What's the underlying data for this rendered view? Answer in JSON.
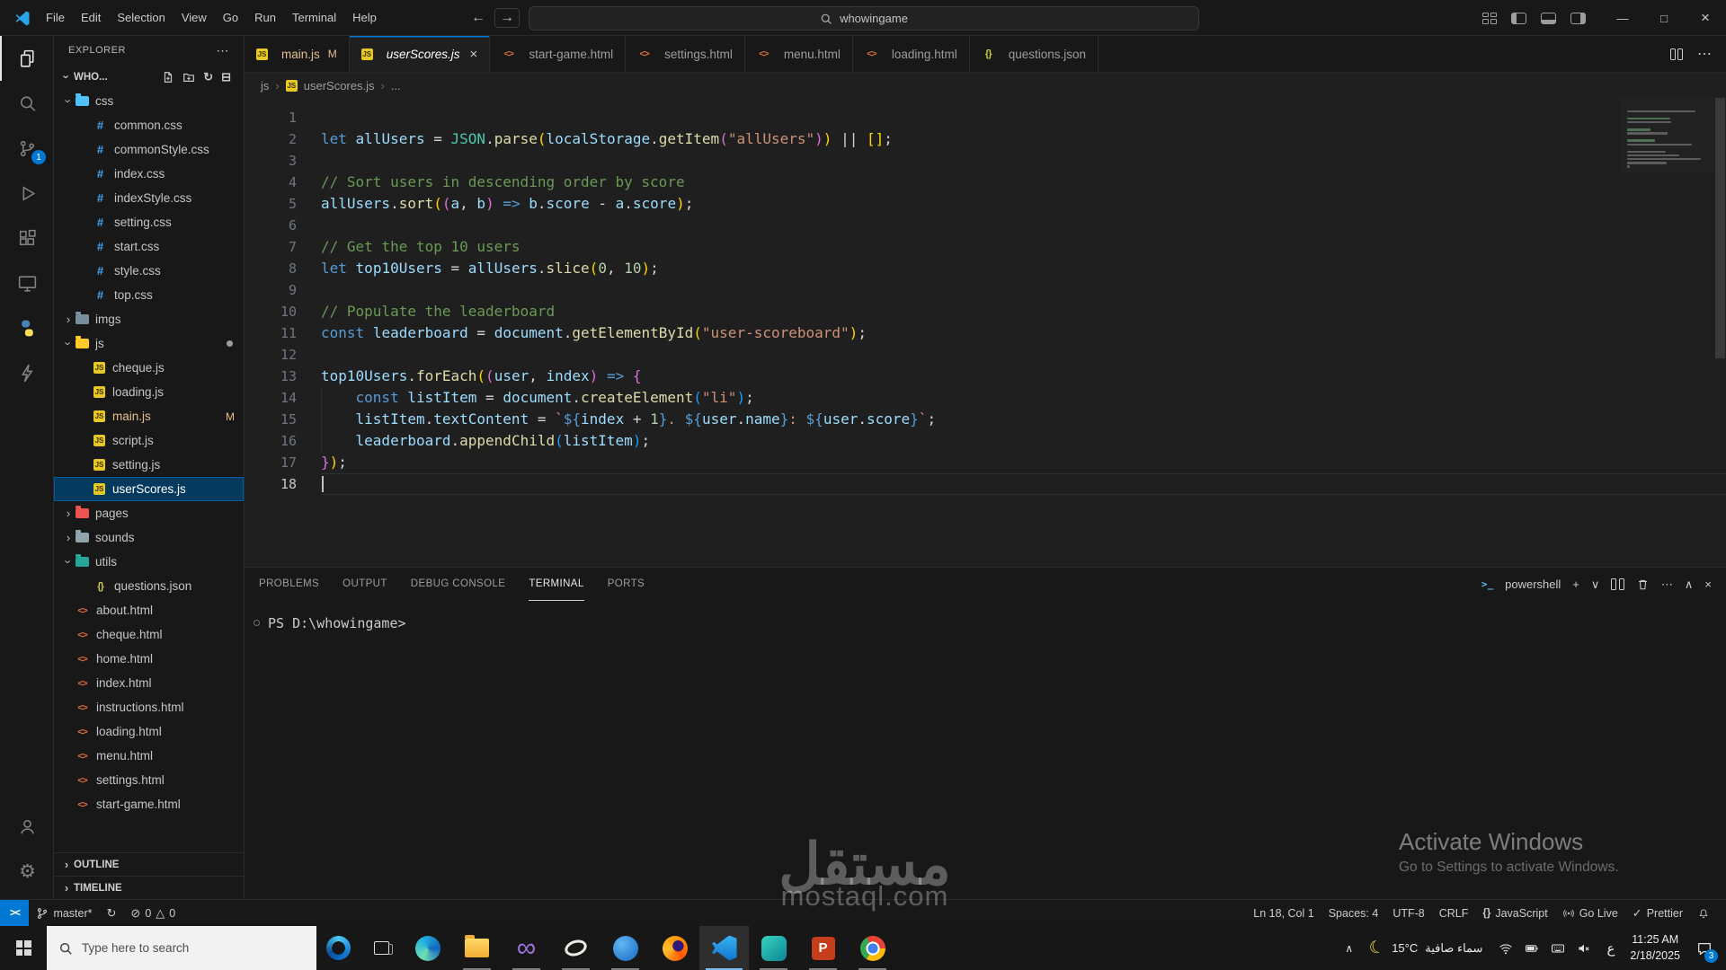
{
  "colors": {
    "accent": "#0078d4",
    "editor_bg": "#1f1f1f",
    "shell_bg": "#181818",
    "border": "#2b2b2b",
    "text": "#cccccc",
    "selection": "#04395e",
    "git_modified": "#e2c08d",
    "tok_kw": "#569cd6",
    "tok_var": "#9cdcfe",
    "tok_fn": "#dcdcaa",
    "tok_cls": "#4ec9b0",
    "tok_str": "#ce9178",
    "tok_num": "#b5cea8",
    "tok_com": "#6a9955",
    "tok_op": "#d4d4d4",
    "tok_b1": "#ffd700",
    "tok_b2": "#da70d6",
    "tok_b3": "#179fff"
  },
  "icons": {
    "back": "←",
    "forward": "→",
    "minimize": "—",
    "maximize": "□",
    "close": "×",
    "more": "⋯",
    "chevron": "›",
    "refresh": "↻",
    "collapse_all": "⊟",
    "plus": "+",
    "chev_down": "∨",
    "chev_up": "∧",
    "gear": "⚙",
    "moon": "☾",
    "error": "⊘",
    "warning": "△",
    "braces": "{}",
    "check": "✓",
    "prompt": ">_"
  },
  "file_icon_glyphs": {
    "js": "JS",
    "css": "#",
    "html": "<>",
    "json": "{}"
  },
  "window": {
    "menus": [
      "File",
      "Edit",
      "Selection",
      "View",
      "Go",
      "Run",
      "Terminal",
      "Help"
    ],
    "search": "whowingame"
  },
  "activity": {
    "scm_badge": "1"
  },
  "explorer": {
    "panel_title": "EXPLORER",
    "root": "WHO...",
    "sections": [
      "OUTLINE",
      "TIMELINE"
    ],
    "tree": [
      {
        "name": "css",
        "kind": "folder",
        "depth": 0,
        "state": "open",
        "color": "#4fc3f7"
      },
      {
        "name": "common.css",
        "kind": "css",
        "depth": 1
      },
      {
        "name": "commonStyle.css",
        "kind": "css",
        "depth": 1
      },
      {
        "name": "index.css",
        "kind": "css",
        "depth": 1
      },
      {
        "name": "indexStyle.css",
        "kind": "css",
        "depth": 1
      },
      {
        "name": "setting.css",
        "kind": "css",
        "depth": 1
      },
      {
        "name": "start.css",
        "kind": "css",
        "depth": 1
      },
      {
        "name": "style.css",
        "kind": "css",
        "depth": 1
      },
      {
        "name": "top.css",
        "kind": "css",
        "depth": 1
      },
      {
        "name": "imgs",
        "kind": "folder",
        "depth": 0,
        "state": "closed",
        "color": "#78909c"
      },
      {
        "name": "js",
        "kind": "folder",
        "depth": 0,
        "state": "open",
        "color": "#ffca28",
        "dot": true
      },
      {
        "name": "cheque.js",
        "kind": "js",
        "depth": 1
      },
      {
        "name": "loading.js",
        "kind": "js",
        "depth": 1
      },
      {
        "name": "main.js",
        "kind": "js",
        "depth": 1,
        "git": "M"
      },
      {
        "name": "script.js",
        "kind": "js",
        "depth": 1
      },
      {
        "name": "setting.js",
        "kind": "js",
        "depth": 1
      },
      {
        "name": "userScores.js",
        "kind": "js",
        "depth": 1,
        "selected": true
      },
      {
        "name": "pages",
        "kind": "folder",
        "depth": 0,
        "state": "closed",
        "color": "#ef5350"
      },
      {
        "name": "sounds",
        "kind": "folder",
        "depth": 0,
        "state": "closed",
        "color": "#90a4ae"
      },
      {
        "name": "utils",
        "kind": "folder",
        "depth": 0,
        "state": "open",
        "color": "#26a69a"
      },
      {
        "name": "questions.json",
        "kind": "json",
        "depth": 1
      },
      {
        "name": "about.html",
        "kind": "html",
        "depth": 0
      },
      {
        "name": "cheque.html",
        "kind": "html",
        "depth": 0
      },
      {
        "name": "home.html",
        "kind": "html",
        "depth": 0
      },
      {
        "name": "index.html",
        "kind": "html",
        "depth": 0
      },
      {
        "name": "instructions.html",
        "kind": "html",
        "depth": 0
      },
      {
        "name": "loading.html",
        "kind": "html",
        "depth": 0
      },
      {
        "name": "menu.html",
        "kind": "html",
        "depth": 0
      },
      {
        "name": "settings.html",
        "kind": "html",
        "depth": 0
      },
      {
        "name": "start-game.html",
        "kind": "html",
        "depth": 0
      }
    ]
  },
  "tabs": [
    {
      "label": "main.js",
      "kind": "js",
      "badge": "M",
      "modified": true
    },
    {
      "label": "userScores.js",
      "kind": "js",
      "active": true,
      "preview": true
    },
    {
      "label": "start-game.html",
      "kind": "html"
    },
    {
      "label": "settings.html",
      "kind": "html"
    },
    {
      "label": "menu.html",
      "kind": "html"
    },
    {
      "label": "loading.html",
      "kind": "html"
    },
    {
      "label": "questions.json",
      "kind": "json"
    }
  ],
  "breadcrumb": {
    "folder": "js",
    "file": "userScores.js",
    "tail": "..."
  },
  "code": {
    "active_line": 18,
    "lines": [
      {
        "n": 1,
        "t": []
      },
      {
        "n": 2,
        "t": [
          [
            "kw",
            "let"
          ],
          [
            "t",
            " "
          ],
          [
            "var",
            "allUsers"
          ],
          [
            "t",
            " "
          ],
          [
            "op",
            "="
          ],
          [
            "t",
            " "
          ],
          [
            "cls",
            "JSON"
          ],
          [
            "t",
            "."
          ],
          [
            "fn",
            "parse"
          ],
          [
            "b1",
            "("
          ],
          [
            "var",
            "localStorage"
          ],
          [
            "t",
            "."
          ],
          [
            "fn",
            "getItem"
          ],
          [
            "b2",
            "("
          ],
          [
            "str",
            "\"allUsers\""
          ],
          [
            "b2",
            ")"
          ],
          [
            "b1",
            ")"
          ],
          [
            "t",
            " "
          ],
          [
            "op",
            "||"
          ],
          [
            "t",
            " "
          ],
          [
            "b1",
            "[]"
          ],
          [
            "t",
            ";"
          ]
        ]
      },
      {
        "n": 3,
        "t": []
      },
      {
        "n": 4,
        "t": [
          [
            "com",
            "// Sort users in descending order by score"
          ]
        ]
      },
      {
        "n": 5,
        "t": [
          [
            "var",
            "allUsers"
          ],
          [
            "t",
            "."
          ],
          [
            "fn",
            "sort"
          ],
          [
            "b1",
            "("
          ],
          [
            "b2",
            "("
          ],
          [
            "var",
            "a"
          ],
          [
            "t",
            ", "
          ],
          [
            "var",
            "b"
          ],
          [
            "b2",
            ")"
          ],
          [
            "t",
            " "
          ],
          [
            "kw",
            "=>"
          ],
          [
            "t",
            " "
          ],
          [
            "var",
            "b"
          ],
          [
            "t",
            "."
          ],
          [
            "var",
            "score"
          ],
          [
            "t",
            " "
          ],
          [
            "op",
            "-"
          ],
          [
            "t",
            " "
          ],
          [
            "var",
            "a"
          ],
          [
            "t",
            "."
          ],
          [
            "var",
            "score"
          ],
          [
            "b1",
            ")"
          ],
          [
            "t",
            ";"
          ]
        ]
      },
      {
        "n": 6,
        "t": []
      },
      {
        "n": 7,
        "t": [
          [
            "com",
            "// Get the top 10 users"
          ]
        ]
      },
      {
        "n": 8,
        "t": [
          [
            "kw",
            "let"
          ],
          [
            "t",
            " "
          ],
          [
            "var",
            "top10Users"
          ],
          [
            "t",
            " "
          ],
          [
            "op",
            "="
          ],
          [
            "t",
            " "
          ],
          [
            "var",
            "allUsers"
          ],
          [
            "t",
            "."
          ],
          [
            "fn",
            "slice"
          ],
          [
            "b1",
            "("
          ],
          [
            "num",
            "0"
          ],
          [
            "t",
            ", "
          ],
          [
            "num",
            "10"
          ],
          [
            "b1",
            ")"
          ],
          [
            "t",
            ";"
          ]
        ]
      },
      {
        "n": 9,
        "t": []
      },
      {
        "n": 10,
        "t": [
          [
            "com",
            "// Populate the leaderboard"
          ]
        ]
      },
      {
        "n": 11,
        "t": [
          [
            "kw",
            "const"
          ],
          [
            "t",
            " "
          ],
          [
            "var",
            "leaderboard"
          ],
          [
            "t",
            " "
          ],
          [
            "op",
            "="
          ],
          [
            "t",
            " "
          ],
          [
            "var",
            "document"
          ],
          [
            "t",
            "."
          ],
          [
            "fn",
            "getElementById"
          ],
          [
            "b1",
            "("
          ],
          [
            "str",
            "\"user-scoreboard\""
          ],
          [
            "b1",
            ")"
          ],
          [
            "t",
            ";"
          ]
        ]
      },
      {
        "n": 12,
        "t": []
      },
      {
        "n": 13,
        "t": [
          [
            "var",
            "top10Users"
          ],
          [
            "t",
            "."
          ],
          [
            "fn",
            "forEach"
          ],
          [
            "b1",
            "("
          ],
          [
            "b2",
            "("
          ],
          [
            "var",
            "user"
          ],
          [
            "t",
            ", "
          ],
          [
            "var",
            "index"
          ],
          [
            "b2",
            ")"
          ],
          [
            "t",
            " "
          ],
          [
            "kw",
            "=>"
          ],
          [
            "t",
            " "
          ],
          [
            "b2",
            "{"
          ]
        ]
      },
      {
        "n": 14,
        "t": [
          [
            "t",
            "    "
          ],
          [
            "kw",
            "const"
          ],
          [
            "t",
            " "
          ],
          [
            "var",
            "listItem"
          ],
          [
            "t",
            " "
          ],
          [
            "op",
            "="
          ],
          [
            "t",
            " "
          ],
          [
            "var",
            "document"
          ],
          [
            "t",
            "."
          ],
          [
            "fn",
            "createElement"
          ],
          [
            "b3",
            "("
          ],
          [
            "str",
            "\"li\""
          ],
          [
            "b3",
            ")"
          ],
          [
            "t",
            ";"
          ]
        ]
      },
      {
        "n": 15,
        "t": [
          [
            "t",
            "    "
          ],
          [
            "var",
            "listItem"
          ],
          [
            "t",
            "."
          ],
          [
            "var",
            "textContent"
          ],
          [
            "t",
            " "
          ],
          [
            "op",
            "="
          ],
          [
            "t",
            " "
          ],
          [
            "str",
            "`"
          ],
          [
            "tpl",
            "${"
          ],
          [
            "var",
            "index"
          ],
          [
            "t",
            " "
          ],
          [
            "op",
            "+"
          ],
          [
            "t",
            " "
          ],
          [
            "num",
            "1"
          ],
          [
            "tpl",
            "}"
          ],
          [
            "str",
            ". "
          ],
          [
            "tpl",
            "${"
          ],
          [
            "var",
            "user"
          ],
          [
            "t",
            "."
          ],
          [
            "var",
            "name"
          ],
          [
            "tpl",
            "}"
          ],
          [
            "str",
            ": "
          ],
          [
            "tpl",
            "${"
          ],
          [
            "var",
            "user"
          ],
          [
            "t",
            "."
          ],
          [
            "var",
            "score"
          ],
          [
            "tpl",
            "}"
          ],
          [
            "str",
            "`"
          ],
          [
            "t",
            ";"
          ]
        ]
      },
      {
        "n": 16,
        "t": [
          [
            "t",
            "    "
          ],
          [
            "var",
            "leaderboard"
          ],
          [
            "t",
            "."
          ],
          [
            "fn",
            "appendChild"
          ],
          [
            "b3",
            "("
          ],
          [
            "var",
            "listItem"
          ],
          [
            "b3",
            ")"
          ],
          [
            "t",
            ";"
          ]
        ]
      },
      {
        "n": 17,
        "t": [
          [
            "b2",
            "}"
          ],
          [
            "b1",
            ")"
          ],
          [
            "t",
            ";"
          ]
        ]
      },
      {
        "n": 18,
        "t": []
      }
    ]
  },
  "panel": {
    "tabs": [
      "PROBLEMS",
      "OUTPUT",
      "DEBUG CONSOLE",
      "TERMINAL",
      "PORTS"
    ],
    "active_tab": "TERMINAL",
    "shell_label": "powershell",
    "prompt": "PS D:\\whowingame>"
  },
  "status": {
    "remote": "><",
    "branch": "master*",
    "errors": "0",
    "warnings": "0",
    "line_col": "Ln 18, Col 1",
    "spaces": "Spaces: 4",
    "encoding": "UTF-8",
    "eol": "CRLF",
    "language": "JavaScript",
    "live": "Go Live",
    "formatter": "Prettier"
  },
  "taskbar": {
    "search_placeholder": "Type here to search",
    "apps": [
      {
        "name": "edge",
        "open": false
      },
      {
        "name": "file-explorer",
        "open": true
      },
      {
        "name": "visual-studio",
        "open": true
      },
      {
        "name": "oval-app",
        "open": true
      },
      {
        "name": "blue-app",
        "open": true
      },
      {
        "name": "firefox",
        "open": false
      },
      {
        "name": "vscode",
        "open": true,
        "active": true
      },
      {
        "name": "teal-app",
        "open": true
      },
      {
        "name": "powerpoint",
        "open": true
      },
      {
        "name": "chrome",
        "open": true
      }
    ],
    "weather_temp": "15°C",
    "weather_desc": "سماء صافية",
    "lang": "ع",
    "time": "11:25 AM",
    "date": "2/18/2025",
    "notif_count": "3"
  },
  "watermark": {
    "line1": "Activate Windows",
    "line2": "Go to Settings to activate Windows.",
    "center_top": "مستقل",
    "center_bottom": "mostaql.com"
  }
}
